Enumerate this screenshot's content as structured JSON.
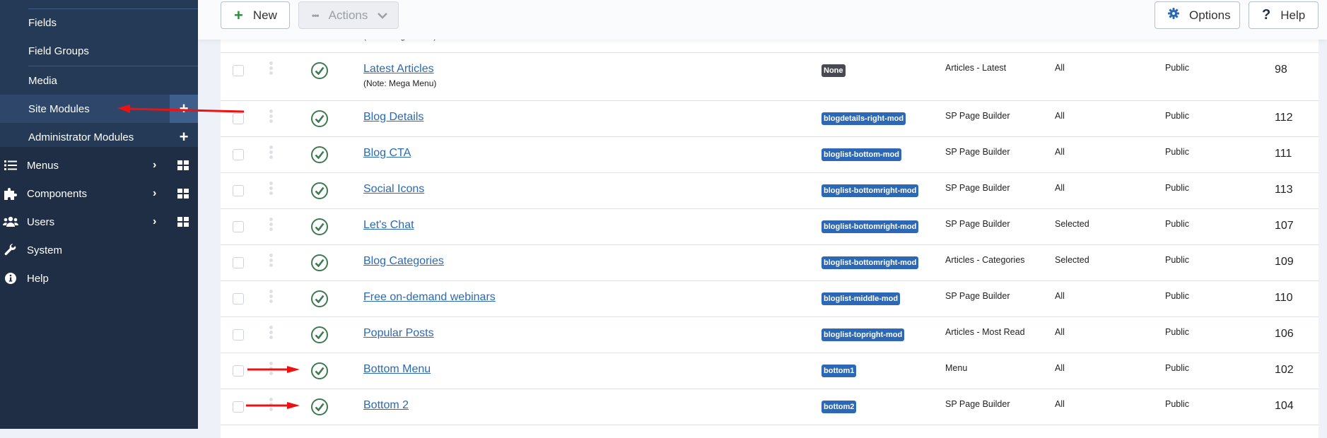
{
  "sidebar": {
    "sub_items": [
      {
        "label": "Fields"
      },
      {
        "label": "Field Groups"
      },
      {
        "label": "Media"
      },
      {
        "label": "Site Modules",
        "active": true,
        "add": "+"
      },
      {
        "label": "Administrator Modules",
        "add": "+"
      }
    ],
    "nav_items": [
      {
        "label": "Menus",
        "icon": "list-icon",
        "chevron": "›"
      },
      {
        "label": "Components",
        "icon": "puzzle-icon",
        "chevron": "›"
      },
      {
        "label": "Users",
        "icon": "users-icon",
        "chevron": "›"
      },
      {
        "label": "System",
        "icon": "wrench-icon"
      },
      {
        "label": "Help",
        "icon": "info-icon"
      }
    ]
  },
  "toolbar": {
    "new_icon": "+",
    "new_label": "New",
    "actions_icon": "•••",
    "actions_label": "Actions",
    "options_label": "Options",
    "help_icon": "?",
    "help_label": "Help"
  },
  "table": {
    "partial_top_note": "(Note: Mega Menu)",
    "rows": [
      {
        "title": "Latest Articles",
        "note": "(Note: Mega Menu)",
        "position": "None",
        "position_none": true,
        "type": "Articles - Latest",
        "pages": "All",
        "access": "Public",
        "id": "98"
      },
      {
        "title": "Blog Details",
        "position": "blogdetails-right-mod",
        "type": "SP Page Builder",
        "pages": "All",
        "access": "Public",
        "id": "112"
      },
      {
        "title": "Blog CTA",
        "position": "bloglist-bottom-mod",
        "type": "SP Page Builder",
        "pages": "All",
        "access": "Public",
        "id": "111"
      },
      {
        "title": "Social Icons",
        "position": "bloglist-bottomright-mod",
        "type": "SP Page Builder",
        "pages": "All",
        "access": "Public",
        "id": "113"
      },
      {
        "title": "Let's Chat",
        "position": "bloglist-bottomright-mod",
        "type": "SP Page Builder",
        "pages": "Selected",
        "access": "Public",
        "id": "107"
      },
      {
        "title": "Blog Categories",
        "position": "bloglist-bottomright-mod",
        "type": "Articles - Categories",
        "pages": "Selected",
        "access": "Public",
        "id": "109"
      },
      {
        "title": "Free on-demand webinars",
        "position": "bloglist-middle-mod",
        "type": "SP Page Builder",
        "pages": "All",
        "access": "Public",
        "id": "110"
      },
      {
        "title": "Popular Posts",
        "position": "bloglist-topright-mod",
        "type": "Articles - Most Read",
        "pages": "All",
        "access": "Public",
        "id": "106"
      },
      {
        "title": "Bottom Menu",
        "position": "bottom1",
        "type": "Menu",
        "pages": "All",
        "access": "Public",
        "id": "102"
      },
      {
        "title": "Bottom 2",
        "position": "bottom2",
        "type": "SP Page Builder",
        "pages": "All",
        "access": "Public",
        "id": "104"
      }
    ]
  },
  "colors": {
    "sidebar_bg": "#1f2e45",
    "sidebar_sub_bg": "#253a57",
    "link": "#2a69b8",
    "badge": "#2c68b6",
    "badge_none": "#474b51",
    "published": "#3d7a4f",
    "annotation_arrow": "#ee1111"
  }
}
